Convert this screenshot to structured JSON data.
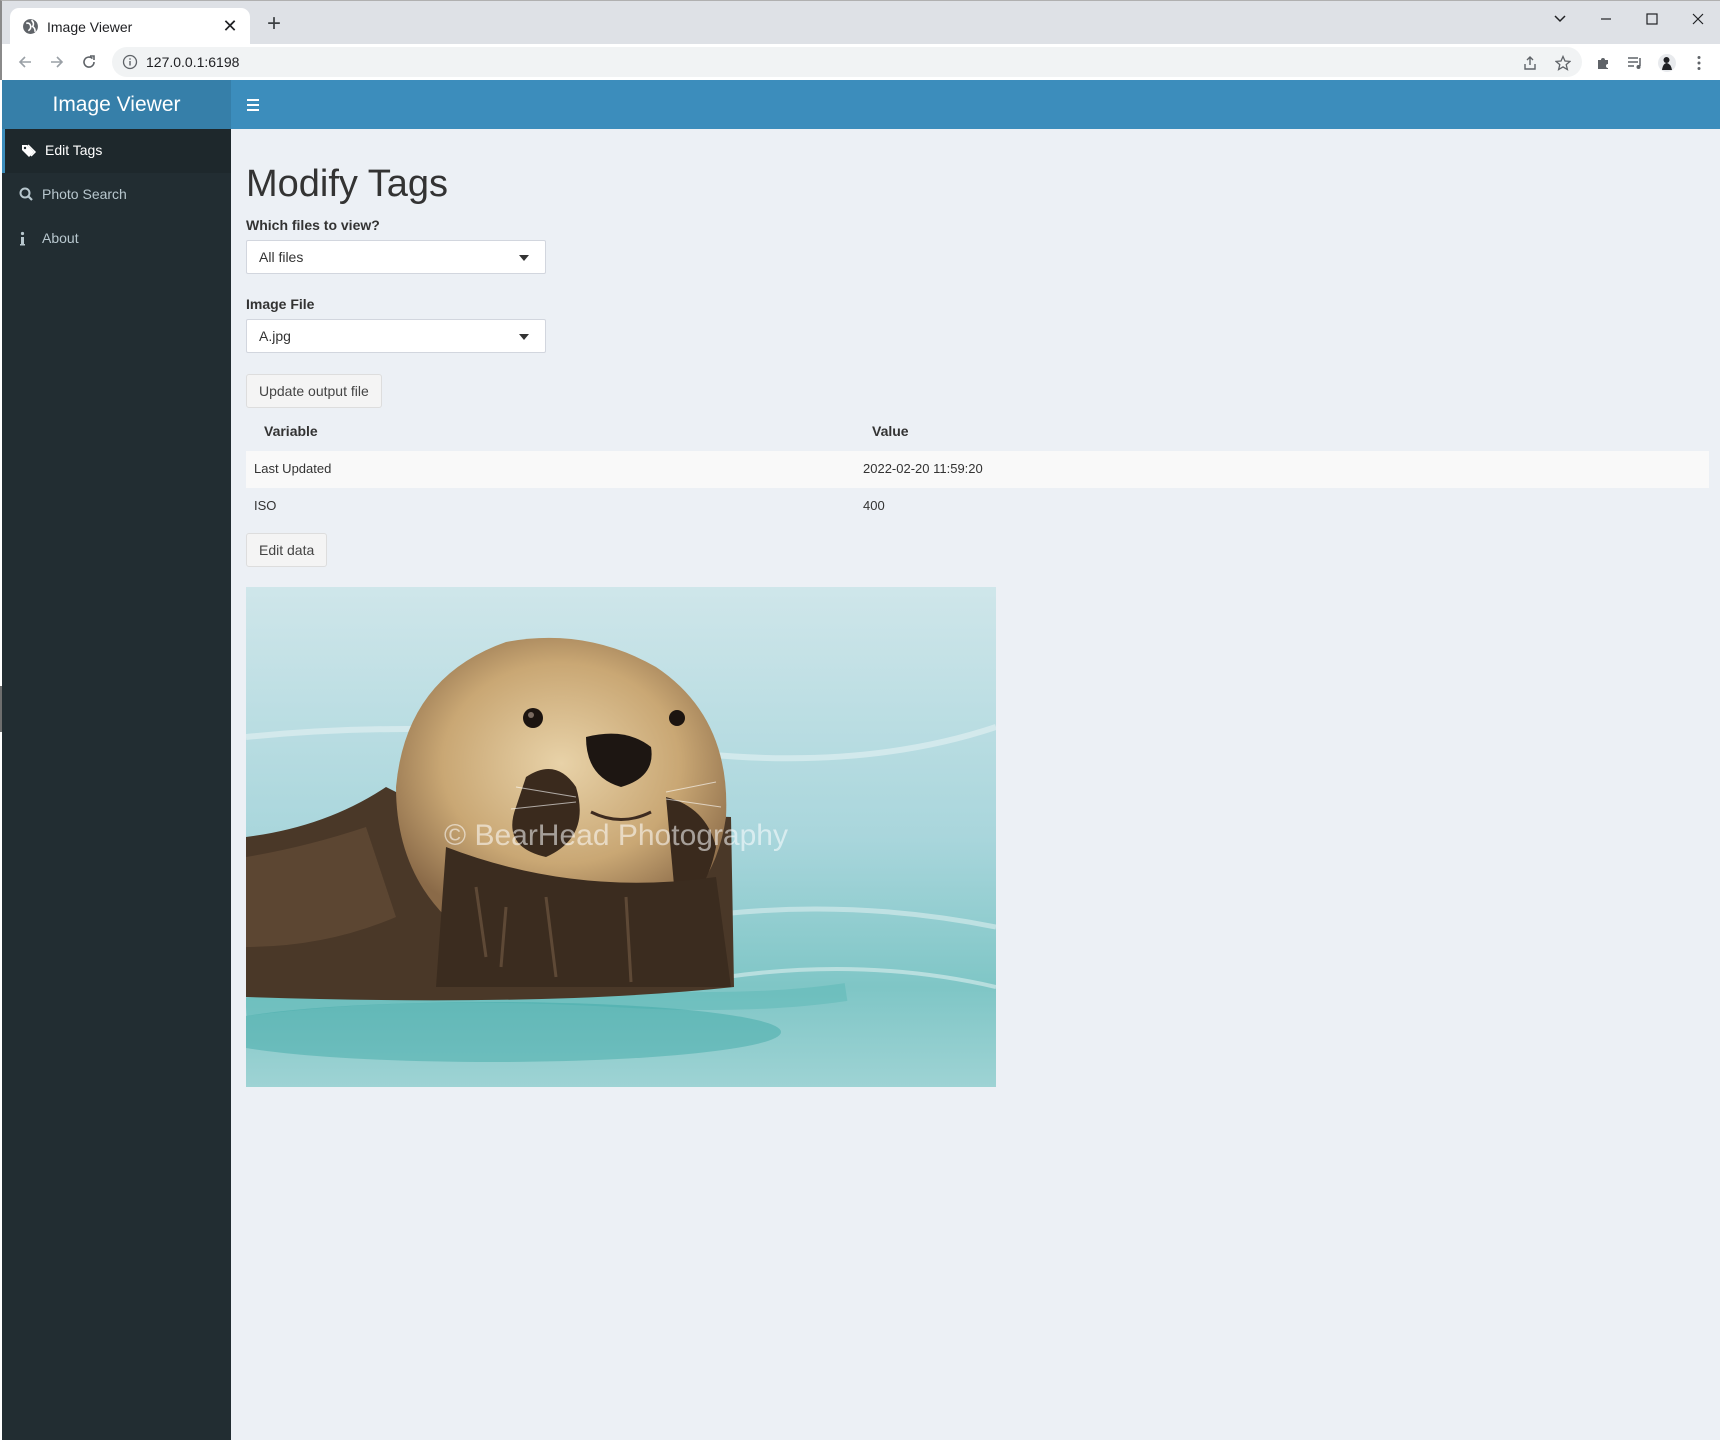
{
  "browser": {
    "tab_title": "Image Viewer",
    "url": "127.0.0.1:6198"
  },
  "app": {
    "logo": "Image Viewer",
    "brand_color": "#3c8dbc",
    "sidebar_color": "#222d32",
    "sidebar": {
      "items": [
        {
          "label": "Edit Tags",
          "icon": "tags-icon",
          "active": true
        },
        {
          "label": "Photo Search",
          "icon": "search-icon",
          "active": false
        },
        {
          "label": "About",
          "icon": "info-icon",
          "active": false
        }
      ]
    }
  },
  "main": {
    "title": "Modify Tags",
    "files_filter": {
      "label": "Which files to view?",
      "value": "All files"
    },
    "image_file": {
      "label": "Image File",
      "value": "A.jpg"
    },
    "update_button": "Update output file",
    "table": {
      "headers": [
        "Variable",
        "Value"
      ],
      "rows": [
        [
          "Last Updated",
          "2022-02-20 11:59:20"
        ],
        [
          "ISO",
          "400"
        ]
      ]
    },
    "edit_button": "Edit data",
    "image_watermark": "© BearHead Photography"
  }
}
